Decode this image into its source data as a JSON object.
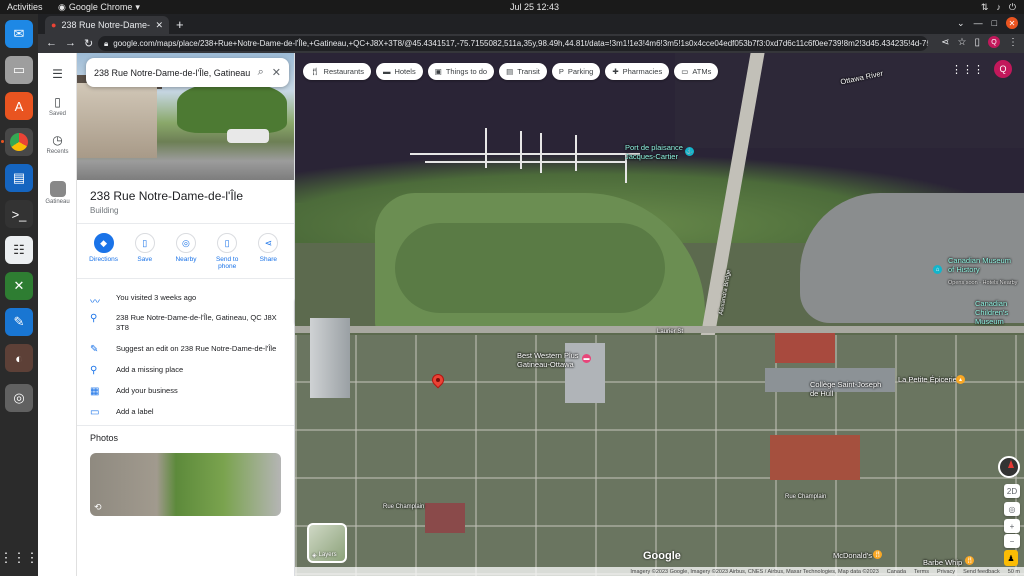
{
  "os": {
    "activities": "Activities",
    "app_menu": "Google Chrome",
    "clock": "Jul 25  12:43",
    "tray": [
      "network-icon",
      "volume-icon",
      "power-icon"
    ]
  },
  "dock": {
    "items": [
      "thunderbird-icon",
      "files-icon",
      "app-center-icon",
      "chrome-icon",
      "writer-icon",
      "terminal-icon",
      "notes-icon",
      "remmina-icon",
      "text-editor-icon",
      "gimp-icon",
      "disk-icon"
    ],
    "show_apps_icon": "grid-icon"
  },
  "browser": {
    "tab_title": "238 Rue Notre-Dame-de-l'Î",
    "new_tab": "+",
    "url": "google.com/maps/place/238+Rue+Notre-Dame-de-l'Île,+Gatineau,+QC+J8X+3T8/@45.4341517,-75.7155082,511a,35y,98.49h,44.81t/data=!3m1!1e3!4m6!3m5!1s0x4cce04edf053b7f3:0xd7d6c11c6f0ee739!8m2!3d45.434235!4d-75.710...",
    "profile_initial": "Q"
  },
  "rail": {
    "menu_icon": "menu-icon",
    "saved": "Saved",
    "recents": "Recents",
    "gatineau": "Gatineau"
  },
  "panel": {
    "search_value": "238 Rue Notre-Dame-de-l'Île, Gatineau",
    "title": "238 Rue Notre-Dame-de-l'Île",
    "type": "Building",
    "actions": {
      "directions": "Directions",
      "save": "Save",
      "nearby": "Nearby",
      "send_to_phone": "Send to phone",
      "share": "Share"
    },
    "visited": "You visited 3 weeks ago",
    "address": "238 Rue Notre-Dame-de-l'Île, Gatineau, QC J8X 3T8",
    "suggest_edit": "Suggest an edit on 238 Rue Notre-Dame-de-l'Île",
    "add_missing": "Add a missing place",
    "add_business": "Add your business",
    "add_label": "Add a label",
    "photos_heading": "Photos"
  },
  "map": {
    "chips": [
      "Restaurants",
      "Hotels",
      "Things to do",
      "Transit",
      "Parking",
      "Pharmacies",
      "ATMs"
    ],
    "avatar_initial": "Q",
    "labels": {
      "river": "Ottawa River",
      "marina": "Port de plaisance Jacques-Cartier",
      "street_laurier": "Laurier St",
      "street_alexandra": "Alexandra Bridge",
      "hotel": "Best Western Plus Gatineau-Ottawa",
      "college": "Collège Saint-Joseph de Hull",
      "epicerie": "La Petite Épicerie",
      "museum": "Canadian Museum of History",
      "museum_sub": "Opens soon · Hotels Nearby",
      "childrens": "Canadian Children's Museum",
      "champlain": "Rue Champlain",
      "champlain2": "Rue Champlain",
      "mcdonalds": "McDonald's",
      "barbe": "Barbe Whip"
    },
    "layers": "Layers",
    "mode_2d": "2D",
    "google": "Google",
    "footer": [
      "Imagery ©2023 Google, Imagery ©2023 Airbus, CNES / Airbus, Maxar Technologies, Map data ©2023",
      "Canada",
      "Terms",
      "Privacy",
      "Send feedback",
      "50 m"
    ]
  }
}
